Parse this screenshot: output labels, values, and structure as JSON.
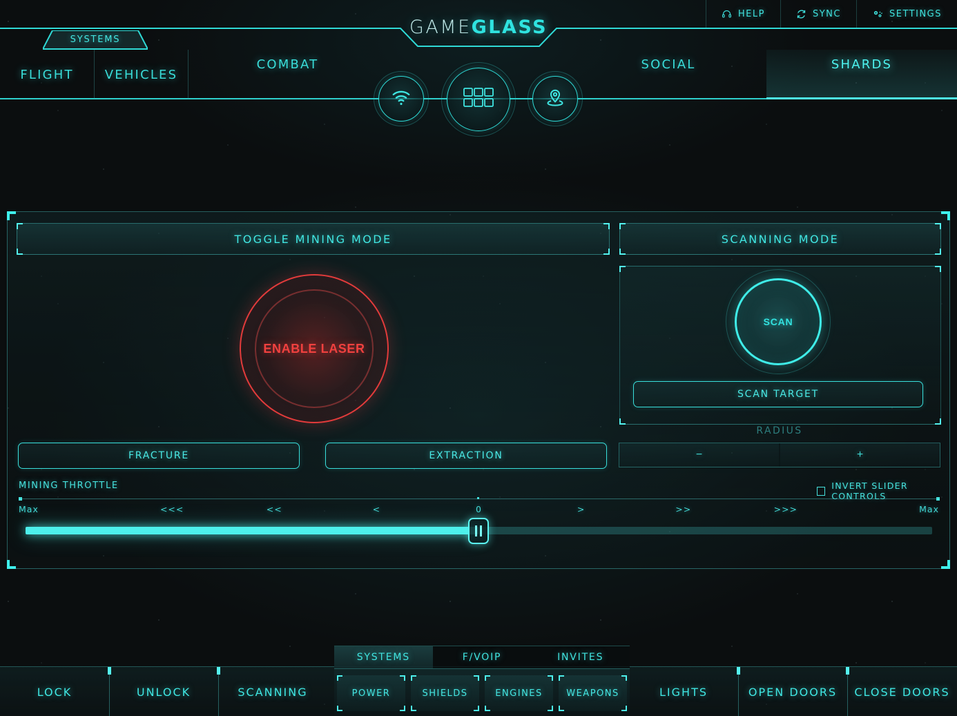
{
  "app": {
    "logo_light": "GAME",
    "logo_bold": "GLASS",
    "accent": "#2fe3e0",
    "accent_bright": "#4df3ef",
    "danger": "#f0413f",
    "background": "#0b0e0f"
  },
  "topbar": {
    "items": [
      {
        "label": "HELP",
        "icon": "headset-icon"
      },
      {
        "label": "SYNC",
        "icon": "refresh-icon"
      },
      {
        "label": "SETTINGS",
        "icon": "gears-icon"
      }
    ]
  },
  "systems_tab": {
    "label": "SYSTEMS"
  },
  "nav": {
    "items": [
      {
        "label": "FLIGHT",
        "active": false
      },
      {
        "label": "VEHICLES",
        "active": false
      },
      {
        "label": "COMBAT",
        "active": false
      },
      {
        "label": "SOCIAL",
        "active": false
      },
      {
        "label": "SHARDS",
        "active": true
      }
    ],
    "icon_buttons": [
      {
        "icon": "wifi-icon",
        "name": "wifi-button"
      },
      {
        "icon": "grid-icon",
        "name": "grid-button"
      },
      {
        "icon": "location-pin-icon",
        "name": "location-button"
      }
    ]
  },
  "mining_panel": {
    "header": "TOGGLE MINING MODE",
    "laser_button": "ENABLE LASER",
    "fracture": "FRACTURE",
    "extraction": "EXTRACTION",
    "throttle_label": "MINING THROTTLE",
    "invert_label": "INVERT SLIDER CONTROLS",
    "invert_checked": false,
    "throttle_ticks": [
      "Max",
      "<<<",
      "<<",
      "<",
      "0",
      ">",
      ">>",
      ">>>",
      "Max"
    ],
    "throttle_value_pct": 50
  },
  "scanning_panel": {
    "header": "SCANNING MODE",
    "scan_button": "SCAN",
    "scan_target": "SCAN TARGET",
    "radius_label": "RADIUS",
    "radius_minus": "−",
    "radius_plus": "+"
  },
  "bottom_bar": {
    "left_buttons": [
      "LOCK",
      "UNLOCK",
      "SCANNING"
    ],
    "right_buttons": [
      "LIGHTS",
      "OPEN DOORS",
      "CLOSE DOORS"
    ],
    "center": {
      "tabs": [
        {
          "label": "SYSTEMS",
          "active": true
        },
        {
          "label": "F/VOIP",
          "active": false
        },
        {
          "label": "INVITES",
          "active": false
        }
      ],
      "cells": [
        "POWER",
        "SHIELDS",
        "ENGINES",
        "WEAPONS"
      ]
    }
  }
}
